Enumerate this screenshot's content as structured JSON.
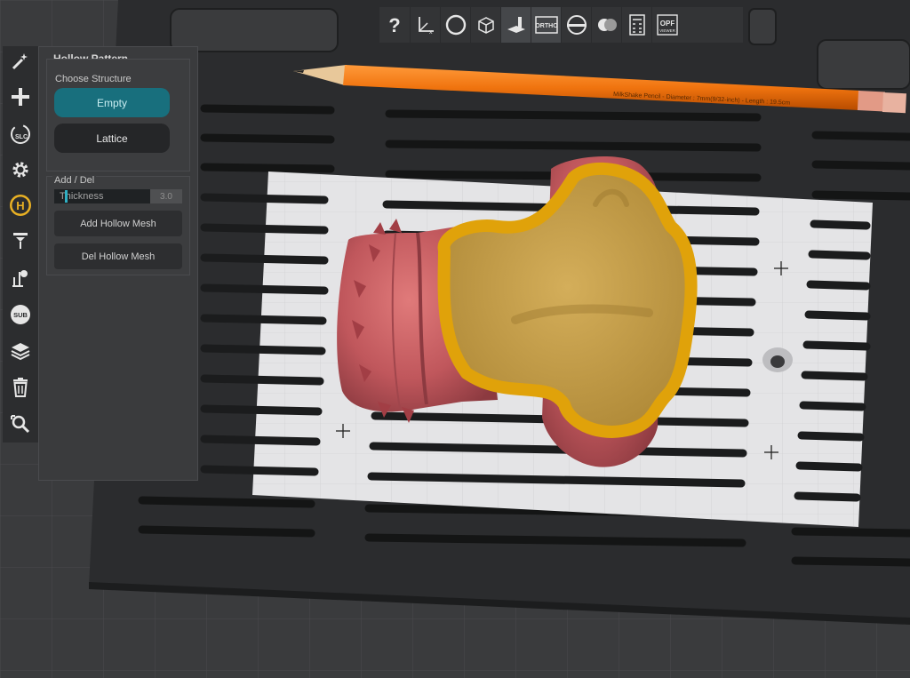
{
  "toolbar": {
    "buttons": [
      {
        "name": "help",
        "icon": "question-icon"
      },
      {
        "name": "axes",
        "icon": "axes-icon"
      },
      {
        "name": "sphere-view",
        "icon": "circle-icon"
      },
      {
        "name": "box-view",
        "icon": "cube-icon"
      },
      {
        "name": "platform-view",
        "icon": "build-platform-icon"
      },
      {
        "name": "ortho",
        "icon": "ortho-icon",
        "label": "ORTHO"
      },
      {
        "name": "section",
        "icon": "cross-section-icon"
      },
      {
        "name": "render-mode",
        "icon": "render-mode-icon"
      },
      {
        "name": "calculator",
        "icon": "calculator-icon"
      },
      {
        "name": "opf",
        "icon": "opf-viewer-icon",
        "label": "OPF",
        "sublabel": "VIEWER"
      }
    ]
  },
  "sidebar": {
    "items": [
      {
        "name": "magic-wand",
        "icon": "magic-wand-icon"
      },
      {
        "name": "add",
        "icon": "plus-icon"
      },
      {
        "name": "slc",
        "icon": "slc-icon",
        "label": "SLC"
      },
      {
        "name": "settings",
        "icon": "gear-icon"
      },
      {
        "name": "hollow",
        "icon": "hollow-icon",
        "label": "H"
      },
      {
        "name": "support",
        "icon": "support-icon"
      },
      {
        "name": "manual-support",
        "icon": "manual-support-icon"
      },
      {
        "name": "subtract",
        "icon": "sub-icon",
        "label": "SUB"
      },
      {
        "name": "layers",
        "icon": "layers-icon"
      },
      {
        "name": "delete",
        "icon": "trash-icon"
      },
      {
        "name": "transform",
        "icon": "transform-icon"
      }
    ]
  },
  "panel": {
    "title": "Hollow Pattern",
    "structure_label": "Choose Structure",
    "structure_options": [
      "Empty",
      "Lattice"
    ],
    "selected_structure": "Empty",
    "add_del_label": "Add / Del",
    "thickness_label": "Thickness",
    "thickness_value": "3.0",
    "add_button": "Add Hollow Mesh",
    "del_button": "Del Hollow Mesh"
  },
  "pencil_text": "MilkShake Pencil - Diameter : 7mm(9/32-inch) - Length : 19.5cm",
  "colors": {
    "accent": "#186f7d",
    "hollow_outline": "#e0a20a",
    "hollow_fill": "#c9a04c",
    "model": "#c0575c",
    "pencil": "#f0740f"
  }
}
